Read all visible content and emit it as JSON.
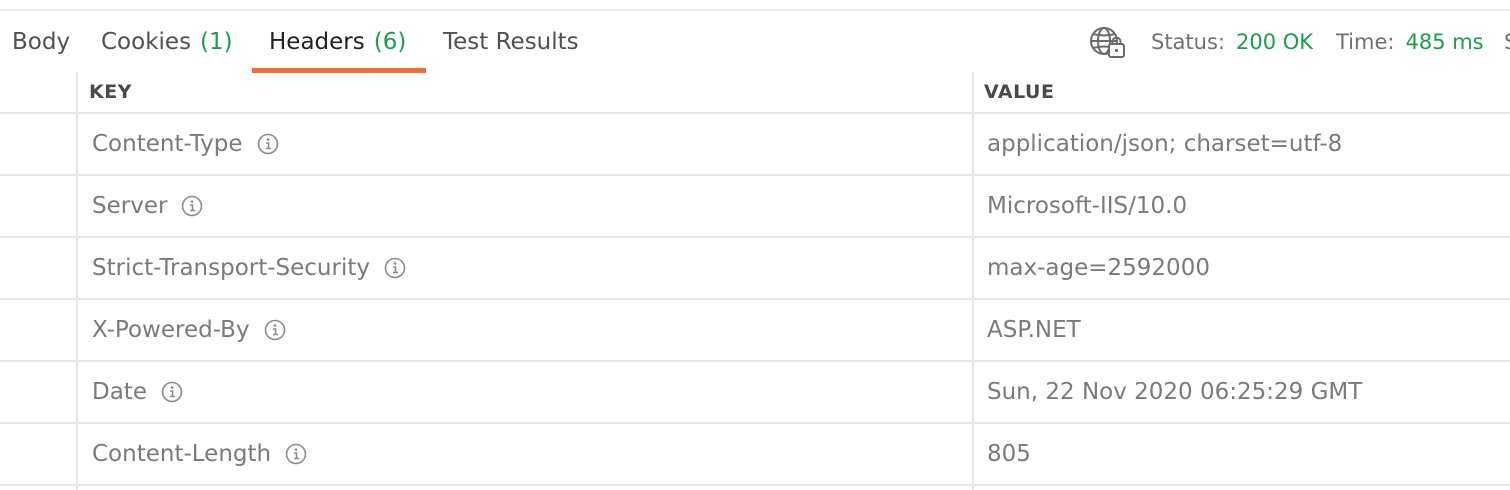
{
  "tabs": [
    {
      "label": "Body",
      "count": ""
    },
    {
      "label": "Cookies",
      "count": "(1)"
    },
    {
      "label": "Headers",
      "count": "(6)",
      "active": true
    },
    {
      "label": "Test Results",
      "count": ""
    }
  ],
  "status": {
    "label": "Status:",
    "value": "200 OK"
  },
  "time": {
    "label": "Time:",
    "value": "485 ms"
  },
  "size_partial": "S",
  "table": {
    "columns": [
      "KEY",
      "VALUE"
    ],
    "rows": [
      {
        "key": "Content-Type",
        "value": "application/json; charset=utf-8"
      },
      {
        "key": "Server",
        "value": "Microsoft-IIS/10.0"
      },
      {
        "key": "Strict-Transport-Security",
        "value": "max-age=2592000"
      },
      {
        "key": "X-Powered-By",
        "value": "ASP.NET"
      },
      {
        "key": "Date",
        "value": "Sun, 22 Nov 2020 06:25:29 GMT"
      },
      {
        "key": "Content-Length",
        "value": "805"
      }
    ]
  },
  "colors": {
    "accent": "#f26b3a",
    "success": "#1f9b4b",
    "muted_text": "#7a7a7a",
    "divider": "#e6e6e6"
  },
  "icons": {
    "certificate": "globe-lock-icon",
    "header_info": "info-circle-icon"
  }
}
